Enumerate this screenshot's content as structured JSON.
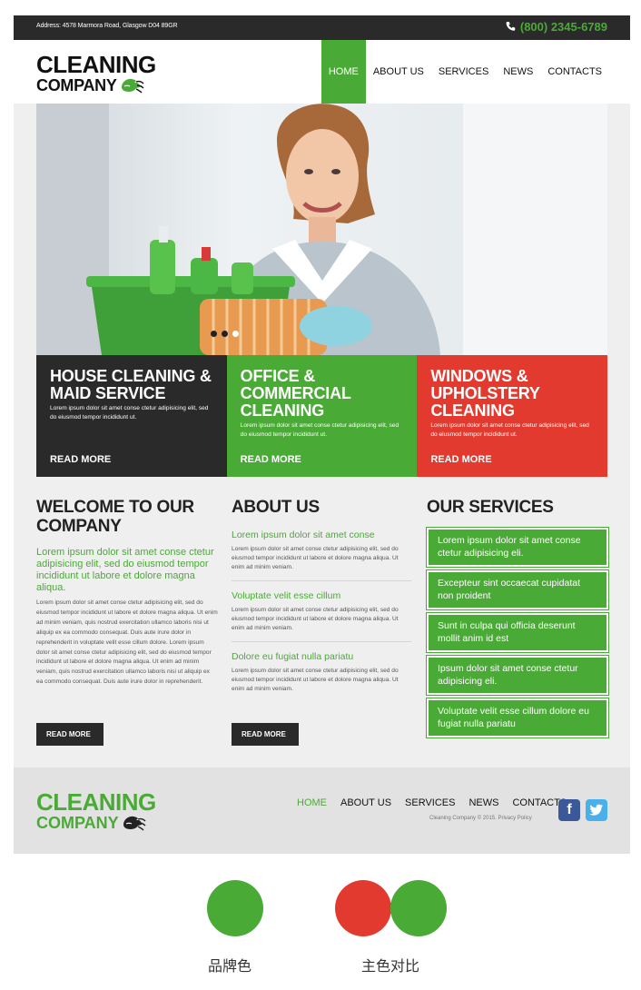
{
  "topbar": {
    "address": "Address: 4578 Marmora Road, Glasgow D04 89GR",
    "phone": "(800) 2345-6789",
    "phone_icon": "phone-icon"
  },
  "logo": {
    "line1": "CLEANING",
    "line2": "COMPANY",
    "icon": "glove-hand-icon"
  },
  "nav": {
    "items": [
      "HOME",
      "ABOUT US",
      "SERVICES",
      "NEWS",
      "CONTACTS"
    ],
    "active": "HOME"
  },
  "slider": {
    "dots": 3,
    "active_dot": 3
  },
  "promos": [
    {
      "title": "HOUSE CLEANING & MAID SERVICE",
      "text": "Lorem ipsum dolor sit amet conse ctetur adipisicing elit, sed do eiusmod tempor incididunt ut.",
      "link": "READ MORE",
      "color": "#2a2a2a"
    },
    {
      "title": "OFFICE & COMMERCIAL CLEANING",
      "text": "Lorem ipsum dolor sit amet conse ctetur adipisicing elit, sed do eiusmod tempor incididunt ut.",
      "link": "READ MORE",
      "color": "#4aaa36"
    },
    {
      "title": "WINDOWS & UPHOLSTERY CLEANING",
      "text": "Lorem ipsum dolor sit amet conse ctetur adipisicing elit, sed do eiusmod tempor incididunt ut.",
      "link": "READ MORE",
      "color": "#e33a2f"
    }
  ],
  "welcome": {
    "title": "WELCOME TO OUR COMPANY",
    "lead": "Lorem ipsum dolor sit amet conse ctetur adipisicing elit, sed do eiusmod tempor incididunt ut labore et dolore magna aliqua.",
    "body": "Lorem ipsum dolor sit amet conse ctetur adipisicing elit, sed do eiusmod tempor incididunt ut labore et dolore magna aliqua. Ut enim ad minim veniam, quis nostrud exercitation ullamco laboris nisi ut aliquip ex ea commodo consequat. Duis aute irure dolor in reprehenderit in voluptate velit esse cillum dolore. Lorem ipsum dolor sit amet conse ctetur adipisicing elit, sed do eiusmod tempor incididunt ut labore et dolore magna aliqua. Ut enim ad minim veniam, quis nostrud exercitation ullamco laboris nisi ut aliquip ex ea commodo consequat. Duis aute irure dolor in reprehenderit.",
    "button": "READ MORE"
  },
  "about": {
    "title": "ABOUT US",
    "items": [
      {
        "heading": "Lorem ipsum dolor sit amet conse",
        "text": "Lorem ipsum dolor sit amet conse ctetur adipisicing elit, sed do eiusmod tempor incididunt ut labore et dolore magna aliqua. Ut enim ad minim veniam."
      },
      {
        "heading": "Voluptate velit esse cillum",
        "text": "Lorem ipsum dolor sit amet conse ctetur adipisicing elit, sed do eiusmod tempor incididunt ut labore et dolore magna aliqua. Ut enim ad minim veniam."
      },
      {
        "heading": "Dolore eu fugiat nulla pariatu",
        "text": "Lorem ipsum dolor sit amet conse ctetur adipisicing elit, sed do eiusmod tempor incididunt ut labore et dolore magna aliqua. Ut enim ad minim veniam."
      }
    ],
    "button": "READ MORE"
  },
  "services": {
    "title": "OUR SERVICES",
    "items": [
      "Lorem ipsum dolor sit amet conse ctetur adipisicing eli.",
      "Excepteur sint occaecat cupidatat non proident",
      "Sunt in culpa qui officia deserunt mollit anim id est",
      "Ipsum dolor sit amet conse ctetur adipisicing eli.",
      "Voluptate velit esse cillum dolore eu fugiat nulla pariatu"
    ]
  },
  "footer": {
    "nav": [
      "HOME",
      "ABOUT US",
      "SERVICES",
      "NEWS",
      "CONTACTS"
    ],
    "copyright": "Cleaning Company © 2015.  Privacy Policy",
    "social": [
      "facebook-icon",
      "twitter-icon"
    ]
  },
  "swatches": {
    "brand_label": "品牌色",
    "brand_color": "#4aaa36",
    "contrast_label": "主色对比",
    "contrast_colors": [
      "#e33a2f",
      "#4aaa36"
    ]
  },
  "colors": {
    "green": "#4aaa36",
    "dark": "#2a2a2a",
    "red": "#e33a2f"
  }
}
